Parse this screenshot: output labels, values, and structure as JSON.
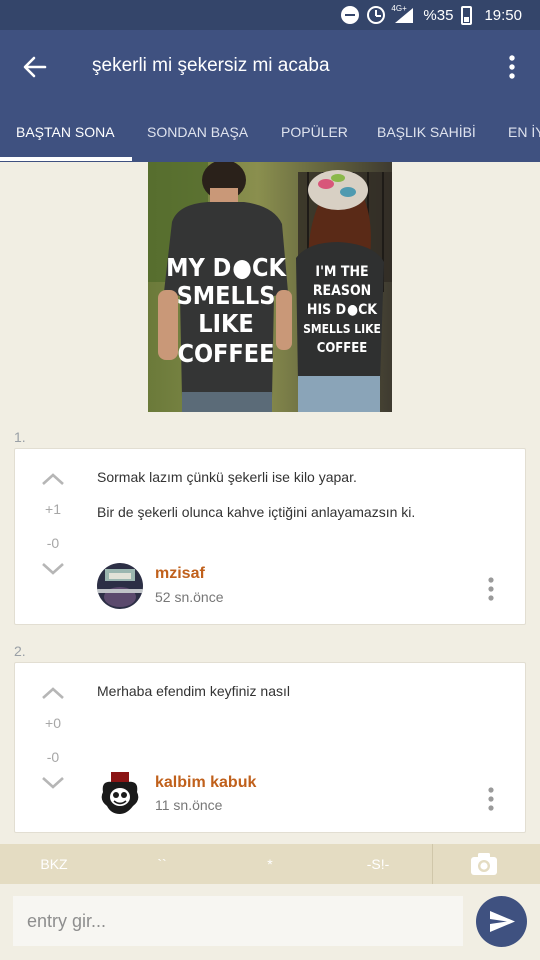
{
  "status_bar": {
    "network": "4G+",
    "battery": "%35",
    "time": "19:50"
  },
  "toolbar": {
    "title": "şekerli mi şekersiz mi acaba"
  },
  "tabs": [
    {
      "label": "BAŞTAN SONA",
      "active": true
    },
    {
      "label": "SONDAN BAŞA",
      "active": false
    },
    {
      "label": "POPÜLER",
      "active": false
    },
    {
      "label": "BAŞLIK SAHİBİ",
      "active": false
    },
    {
      "label": "EN İY",
      "active": false
    }
  ],
  "photo": {
    "left_shirt": [
      "MY D",
      "CK",
      "SMELLS",
      "LIKE",
      "COFFEE"
    ],
    "right_shirt": [
      "I'M THE",
      "REASON",
      "HIS D",
      "CK",
      "SMELLS LIKE",
      "COFFEE"
    ]
  },
  "entries": [
    {
      "number": "1.",
      "lines": [
        "Sormak lazım çünkü şekerli ise kilo yapar.",
        "Bir de şekerli olunca kahve içtiğini anlayamazsın ki."
      ],
      "upvotes": "+1",
      "downvotes": "-0",
      "author": "mzisaf",
      "time": "52 sn.önce"
    },
    {
      "number": "2.",
      "lines": [
        "Merhaba efendim keyfiniz nasıl"
      ],
      "upvotes": "+0",
      "downvotes": "-0",
      "author": "kalbim kabuk",
      "time": "11 sn.önce"
    }
  ],
  "format_bar": {
    "buttons": [
      "BKZ",
      "``",
      "*",
      "-S!-"
    ],
    "camera_icon": "camera-icon"
  },
  "composer": {
    "placeholder": "entry gir...",
    "send_icon": "send-icon"
  },
  "colors": {
    "primary": "#3f5180",
    "status_bar": "#34456a",
    "author": "#c0601b",
    "background": "#f1eee3",
    "format_bar": "#e4dcc2"
  }
}
